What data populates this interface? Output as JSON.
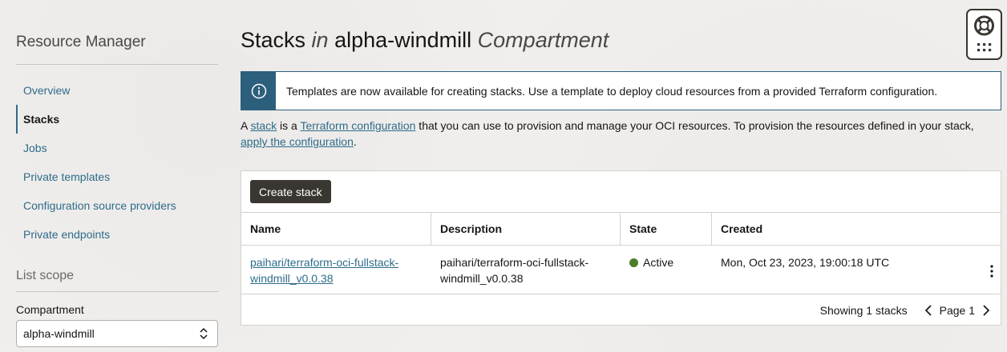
{
  "sidebar": {
    "title": "Resource Manager",
    "items": [
      {
        "label": "Overview"
      },
      {
        "label": "Stacks"
      },
      {
        "label": "Jobs"
      },
      {
        "label": "Private templates"
      },
      {
        "label": "Configuration source providers"
      },
      {
        "label": "Private endpoints"
      }
    ],
    "scope_title": "List scope",
    "compartment_label": "Compartment",
    "compartment_value": "alpha-windmill"
  },
  "header": {
    "title_prefix": "Stacks",
    "title_in": "in",
    "title_compartment": "alpha-windmill",
    "title_suffix": "Compartment"
  },
  "banner": {
    "icon": "info-icon",
    "text": "Templates are now available for creating stacks. Use a template to deploy cloud resources from a provided Terraform configuration."
  },
  "description": {
    "part1": "A ",
    "link1": "stack",
    "part2": " is a ",
    "link2": "Terraform configuration",
    "part3": " that you can use to provision and manage your OCI resources. To provision the resources defined in your stack, ",
    "link3": "apply the configuration",
    "part4": "."
  },
  "toolbar": {
    "create_label": "Create stack"
  },
  "table": {
    "columns": [
      "Name",
      "Description",
      "State",
      "Created"
    ],
    "rows": [
      {
        "name_line1": "paihari/terraform-oci-fullstack-",
        "name_line2": "windmill_v0.0.38",
        "desc_line1": "paihari/terraform-oci-fullstack-",
        "desc_line2": "windmill_v0.0.38",
        "state": "Active",
        "created": "Mon, Oct 23, 2023, 19:00:18 UTC"
      }
    ]
  },
  "footer": {
    "showing": "Showing 1 stacks",
    "page": "Page 1"
  },
  "colors": {
    "accent": "#2c5f7c",
    "link": "#2d6c8a",
    "active_state": "#4b7d2a",
    "button": "#3a3631"
  }
}
